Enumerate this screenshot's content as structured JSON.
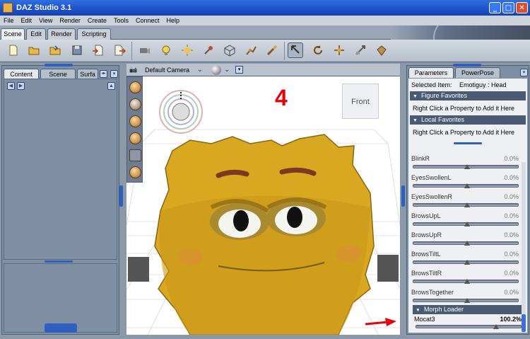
{
  "window": {
    "title": "DAZ Studio 3.1",
    "controls": [
      "_",
      "□",
      "✕"
    ]
  },
  "menu": [
    "File",
    "Edit",
    "View",
    "Render",
    "Create",
    "Tools",
    "Connect",
    "Help"
  ],
  "room_tabs": [
    "Scene",
    "Edit",
    "Render",
    "Scripting"
  ],
  "toolbar_icons": [
    "new-file-icon",
    "open-file-icon",
    "merge-icon",
    "save-icon",
    "import-icon",
    "export-icon",
    "camera-icon",
    "light-icon",
    "spot-light-icon",
    "pin-icon",
    "primitive-cube-icon",
    "joint-editor-icon",
    "pose-brush-icon",
    "node-select-icon",
    "rotate-icon",
    "translate-icon",
    "scale-icon",
    "universal-icon"
  ],
  "left_panel": {
    "tabs": [
      "Content",
      "Scene",
      "Surfa"
    ]
  },
  "viewport": {
    "camera": "Default Camera",
    "corner_label": "Front",
    "overlay_number": "4"
  },
  "right_panel": {
    "tabs": [
      "Parameters",
      "PowerPose"
    ],
    "selected_label": "Selected Item:",
    "selected_value": "Emotiguy : Head",
    "figure_favorites": "Figure Favorites",
    "local_favorites": "Local Favorites",
    "hint": "Right Click a Property to Add it Here",
    "properties": [
      {
        "name": "BlinkR",
        "value": "0.0%",
        "level": 0.5
      },
      {
        "name": "EyesSwollenL",
        "value": "0.0%",
        "level": 0.5
      },
      {
        "name": "EyesSwollenR",
        "value": "0.0%",
        "level": 0.5
      },
      {
        "name": "BrowsUpL",
        "value": "0.0%",
        "level": 0.5
      },
      {
        "name": "BrowsUpR",
        "value": "0.0%",
        "level": 0.5
      },
      {
        "name": "BrowsTiltL",
        "value": "0.0%",
        "level": 0.5
      },
      {
        "name": "BrowsTiltR",
        "value": "0.0%",
        "level": 0.5
      },
      {
        "name": "BrowsTogether",
        "value": "0.0%",
        "level": 0.5
      }
    ],
    "morph_loader": "Morph Loader",
    "mocat": {
      "name": "Mocat3",
      "value": "100.2%",
      "level": 0.75
    }
  },
  "colors": {
    "accent": "#2f5fbf",
    "overlay_number": "#e8000a"
  }
}
